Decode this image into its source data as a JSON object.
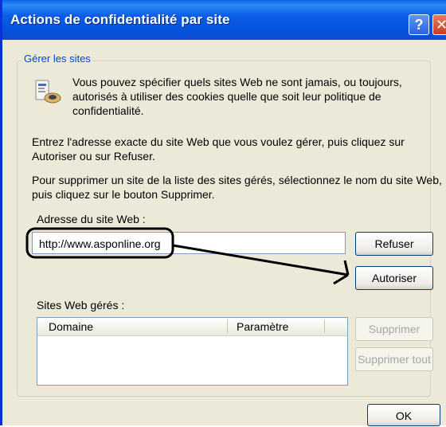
{
  "window": {
    "title": "Actions de confidentialité par site"
  },
  "titlebar": {
    "help_glyph": "?",
    "close_glyph": "✕"
  },
  "group": {
    "legend": "Gérer les sites"
  },
  "info": {
    "line1": "Vous pouvez spécifier quels sites Web ne sont jamais, ou toujours,",
    "line2": "autorisés à utiliser des cookies quelle que soit leur politique de",
    "line3": "confidentialité."
  },
  "instructions": {
    "p1_line1": "Entrez l'adresse exacte du site Web que vous voulez gérer, puis cliquez sur",
    "p1_line2": "Autoriser ou sur Refuser.",
    "p2_line1": "Pour supprimer un site de la liste des sites gérés, sélectionnez le nom du site Web,",
    "p2_line2": "puis cliquez sur le bouton Supprimer."
  },
  "address": {
    "label": "Adresse du site Web :",
    "value": "http://www.asponline.org"
  },
  "buttons": {
    "refuse": "Refuser",
    "allow": "Autoriser",
    "remove": "Supprimer",
    "remove_all": "Supprimer tout",
    "ok": "OK"
  },
  "managed": {
    "label": "Sites Web gérés :",
    "columns": [
      "Domaine",
      "Paramètre"
    ]
  },
  "colors": {
    "title_bar": "#0a5fe8",
    "dialog_bg": "#ece9d8",
    "legend_text": "#0046d5",
    "annotation": "#000000"
  },
  "icons": {
    "help": "help-question-icon",
    "close": "close-x-icon",
    "info": "privacy-info-icon"
  }
}
